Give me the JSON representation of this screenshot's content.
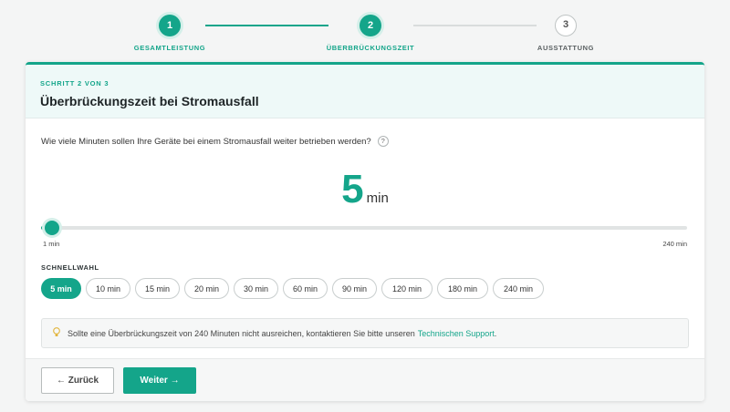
{
  "stepper": {
    "steps": [
      {
        "number": "1",
        "label": "GESAMTLEISTUNG",
        "state": "active"
      },
      {
        "number": "2",
        "label": "ÜBERBRÜCKUNGSZEIT",
        "state": "active"
      },
      {
        "number": "3",
        "label": "AUSSTATTUNG",
        "state": "pending"
      }
    ]
  },
  "card": {
    "kicker": "SCHRITT 2 VON 3",
    "title": "Überbrückungszeit bei Stromausfall",
    "question": "Wie viele Minuten sollen Ihre Geräte bei einem Stromausfall weiter betrieben werden?",
    "help_glyph": "?",
    "value": "5",
    "unit": "min",
    "slider": {
      "min": 1,
      "max": 240,
      "current": 5,
      "min_label": "1 min",
      "max_label": "240 min"
    },
    "quick_label": "SCHNELLWAHL",
    "quick_options": [
      "5 min",
      "10 min",
      "15 min",
      "20 min",
      "30 min",
      "60 min",
      "90 min",
      "120 min",
      "180 min",
      "240 min"
    ],
    "selected_option": "5 min",
    "info_text": "Sollte eine Überbrückungszeit von 240 Minuten nicht ausreichen, kontaktieren Sie bitte unseren",
    "info_link": "Technischen Support",
    "info_end": ".",
    "back_label": "← Zurück",
    "next_label": "Weiter →"
  },
  "colors": {
    "accent": "#14a58a"
  }
}
